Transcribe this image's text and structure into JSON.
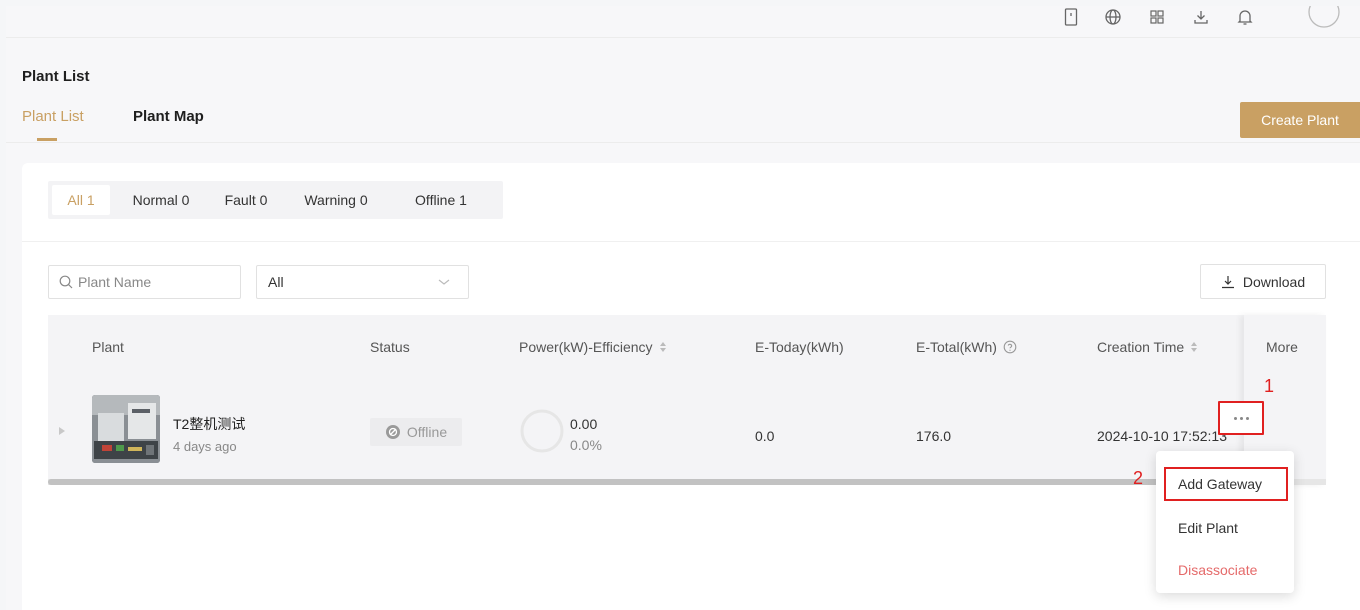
{
  "header": {
    "icons": [
      "mobile-icon",
      "globe-icon",
      "apps-grid-icon",
      "download-icon",
      "bell-icon",
      "avatar"
    ]
  },
  "page": {
    "title": "Plant List",
    "tabs": [
      {
        "label": "Plant List",
        "active": true
      },
      {
        "label": "Plant Map",
        "active": false
      }
    ],
    "create_button": "Create Plant"
  },
  "filters": {
    "status_tabs": [
      {
        "label": "All 1",
        "active": true
      },
      {
        "label": "Normal 0",
        "active": false
      },
      {
        "label": "Fault 0",
        "active": false
      },
      {
        "label": "Warning 0",
        "active": false
      },
      {
        "label": "Offline 1",
        "active": false
      }
    ],
    "search_placeholder": "Plant Name",
    "select_value": "All",
    "download_label": "Download"
  },
  "table": {
    "columns": [
      "Plant",
      "Status",
      "Power(kW)-Efficiency",
      "E-Today(kWh)",
      "E-Total(kWh)",
      "Creation Time",
      "More"
    ],
    "rows": [
      {
        "name": "T2整机测试",
        "age": "4 days ago",
        "status": "Offline",
        "power": "0.00",
        "efficiency": "0.0%",
        "e_today": "0.0",
        "e_total": "176.0",
        "creation_time": "2024-10-10 17:52:13"
      }
    ]
  },
  "more_menu": {
    "items": [
      "Add Gateway",
      "Edit Plant",
      "Disassociate"
    ]
  },
  "annotations": {
    "step1": "1",
    "step2": "2"
  },
  "colors": {
    "accent": "#c9a063",
    "annotation_red": "#e02020",
    "danger": "#e56a6a"
  }
}
